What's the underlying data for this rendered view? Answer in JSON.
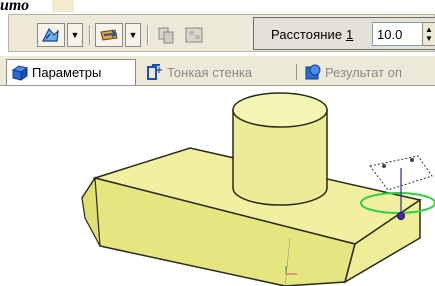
{
  "header_fragment": "ито",
  "toolbar": {
    "buttons": [
      {
        "name": "operation-mode-icon"
      },
      {
        "name": "direction-icon"
      },
      {
        "name": "copy-parts-icon"
      },
      {
        "name": "paste-parts-icon"
      }
    ],
    "distance_label": "Расстояние",
    "distance_index": "1",
    "distance_value": "10.0"
  },
  "tabs": [
    {
      "label": "Параметры",
      "icon": "parameters-icon",
      "active": true
    },
    {
      "label": "Тонкая стенка",
      "icon": "thin-wall-icon",
      "active": false
    },
    {
      "label": "Результат оп",
      "icon": "result-icon",
      "active": false
    }
  ],
  "colors": {
    "model_fill": "#f0f0a0",
    "model_edge": "#2a2a1a",
    "selection_green": "#2fcf40",
    "toolbar_bg": "#ece9d8"
  }
}
